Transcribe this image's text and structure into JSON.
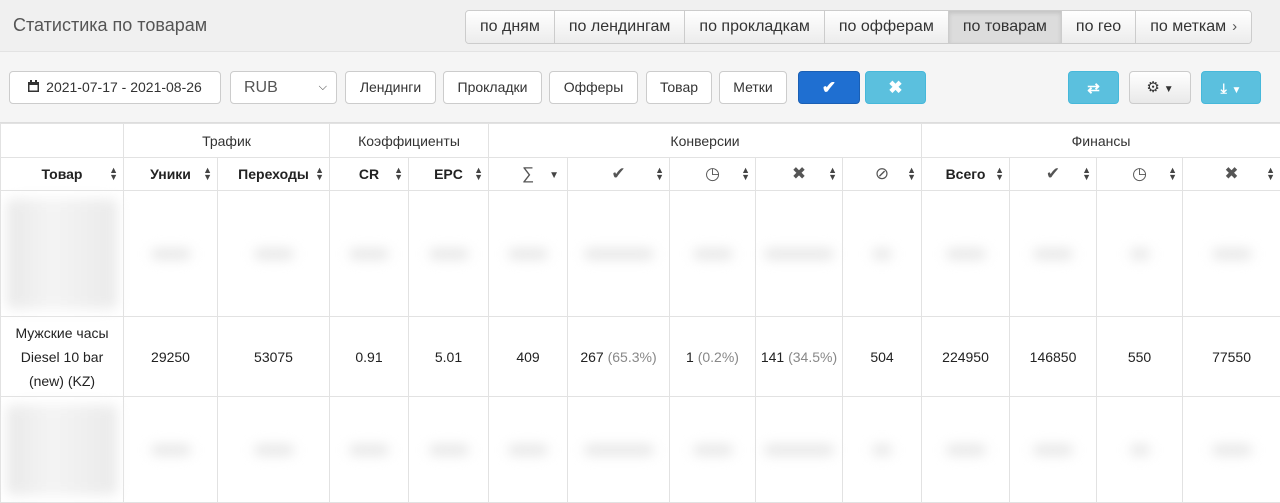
{
  "header": {
    "title": "Статистика по товарам",
    "tabs": [
      {
        "label": "по дням",
        "active": false
      },
      {
        "label": "по лендингам",
        "active": false
      },
      {
        "label": "по прокладкам",
        "active": false
      },
      {
        "label": "по офферам",
        "active": false
      },
      {
        "label": "по товарам",
        "active": true
      },
      {
        "label": "по гео",
        "active": false
      },
      {
        "label": "по меткам",
        "active": false
      }
    ]
  },
  "toolbar": {
    "date_range": "2021-07-17 - 2021-08-26",
    "currency": "RUB",
    "filters": [
      "Лендинги",
      "Прокладки",
      "Офферы",
      "Товар",
      "Метки"
    ],
    "apply_icon": "check-icon",
    "reset_icon": "times-icon",
    "shuffle_icon": "random-icon",
    "settings_icon": "gear-icon",
    "download_icon": "download-icon"
  },
  "table": {
    "groups": [
      "Трафик",
      "Коэффициенты",
      "Конверсии",
      "Финансы"
    ],
    "columns": {
      "product": "Товар",
      "uniques": "Уники",
      "clicks": "Переходы",
      "cr": "CR",
      "epc": "EPC",
      "conv_total": "∑",
      "fin_total": "Всего"
    },
    "row": {
      "product": "Мужские часы Diesel 10 bar (new) (KZ)",
      "uniques": "29250",
      "clicks": "53075",
      "cr": "0.91",
      "epc": "5.01",
      "conv_total": "409",
      "approved": "267",
      "approved_pct": "(65.3%)",
      "pending": "1",
      "pending_pct": "(0.2%)",
      "rejected": "141",
      "rejected_pct": "(34.5%)",
      "trash": "504",
      "fin_total": "224950",
      "fin_approved": "146850",
      "fin_pending": "550",
      "fin_rejected": "77550"
    }
  },
  "colors": {
    "primary": "#1f6fd1",
    "info": "#5bc0de",
    "header_bg": "#f0f0f0"
  }
}
